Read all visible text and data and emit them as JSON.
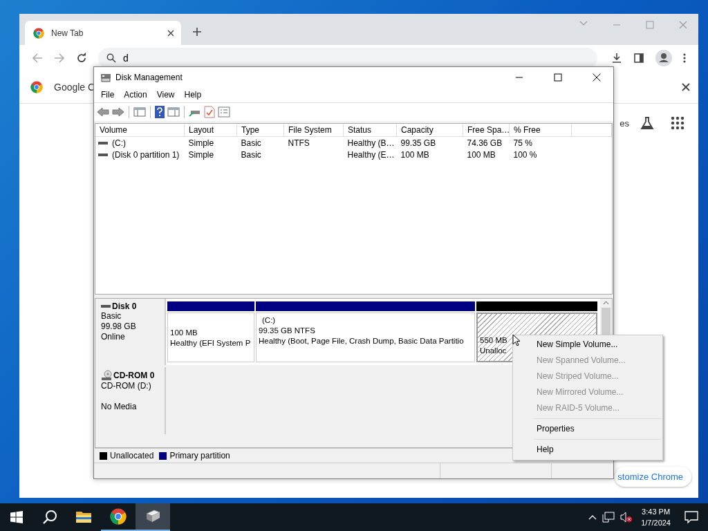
{
  "browser": {
    "tabs": [
      {
        "label": "New Tab",
        "selected": true
      }
    ],
    "address": {
      "value": "d"
    },
    "banner": {
      "text": "Google C"
    },
    "new_tab_page": {
      "partial_text": "es",
      "customize_button": "stomize Chrome"
    }
  },
  "disk_management": {
    "title": "Disk Management",
    "menu": [
      "File",
      "Action",
      "View",
      "Help"
    ],
    "columns": [
      "Volume",
      "Layout",
      "Type",
      "File System",
      "Status",
      "Capacity",
      "Free Spa…",
      "% Free"
    ],
    "volumes": [
      {
        "volume": "(C:)",
        "layout": "Simple",
        "type": "Basic",
        "file_system": "NTFS",
        "status": "Healthy (B…",
        "capacity": "99.35 GB",
        "free_space": "74.36 GB",
        "percent_free": "75 %"
      },
      {
        "volume": "(Disk 0 partition 1)",
        "layout": "Simple",
        "type": "Basic",
        "status": "Healthy (E…",
        "capacity": "100 MB",
        "free_space": "100 MB",
        "percent_free": "100 %"
      }
    ],
    "disks": [
      {
        "kind": "disk",
        "name": "Disk 0",
        "lines": [
          "Basic",
          "99.98 GB",
          "Online"
        ],
        "partitions": [
          {
            "kind": "primary",
            "selected": false,
            "lines": [
              "100 MB",
              "Healthy (EFI System P"
            ]
          },
          {
            "kind": "primary",
            "selected": false,
            "label": "(C:)",
            "lines": [
              "99.35 GB NTFS",
              "Healthy (Boot, Page File, Crash Dump, Basic Data Partitio"
            ]
          },
          {
            "kind": "unallocated",
            "selected": true,
            "lines": [
              "550 MB",
              "Unalloc"
            ]
          }
        ]
      },
      {
        "kind": "cdrom",
        "name": "CD-ROM 0",
        "lines": [
          "CD-ROM (D:)",
          "No Media"
        ]
      }
    ],
    "legend": [
      {
        "label": "Unallocated",
        "color": "#000000"
      },
      {
        "label": "Primary partition",
        "color": "#000080"
      }
    ]
  },
  "context_menu": {
    "groups": [
      [
        {
          "label": "New Simple Volume...",
          "disabled": false
        },
        {
          "label": "New Spanned Volume...",
          "disabled": true
        },
        {
          "label": "New Striped Volume...",
          "disabled": true
        },
        {
          "label": "New Mirrored Volume...",
          "disabled": true
        },
        {
          "label": "New RAID-5 Volume...",
          "disabled": true
        }
      ],
      [
        {
          "label": "Properties",
          "disabled": false
        }
      ],
      [
        {
          "label": "Help",
          "disabled": false
        }
      ]
    ]
  },
  "taskbar": {
    "apps": [
      {
        "kind": "folder",
        "running": false,
        "selected": false
      },
      {
        "kind": "chrome",
        "running": true,
        "selected": false
      },
      {
        "kind": "disk",
        "running": true,
        "selected": true
      }
    ],
    "time": "3:43 PM",
    "date": "1/7/2024"
  }
}
